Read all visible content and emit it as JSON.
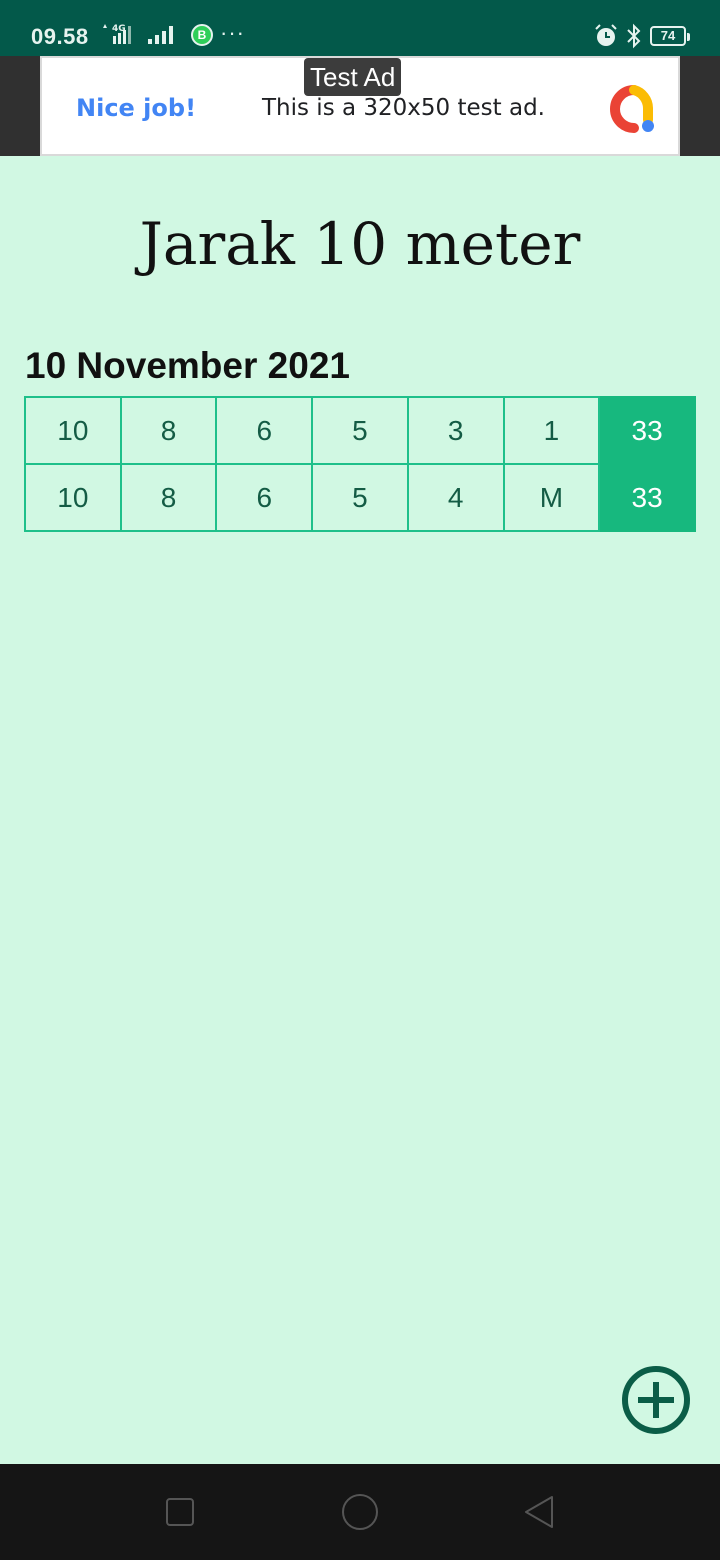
{
  "status_bar": {
    "time": "09.58",
    "network_type": "4G",
    "app_badge": "B",
    "more": "···",
    "battery": "74",
    "icons": [
      "signal-icon",
      "whatsapp-business-icon",
      "alarm-icon",
      "bluetooth-icon",
      "battery-icon"
    ]
  },
  "ad": {
    "label": "Test Ad",
    "headline": "Nice job!",
    "text": "This is a 320x50 test ad.",
    "icon": "adchoices-logo-icon",
    "colors": {
      "headline": "#4285f4",
      "red": "#ea4335",
      "yellow": "#fbbc04",
      "blue": "#4285f4"
    }
  },
  "page": {
    "title": "Jarak 10 meter"
  },
  "session": {
    "date": "10 November 2021",
    "rows": [
      {
        "shots": [
          "10",
          "8",
          "6",
          "5",
          "3",
          "1"
        ],
        "total": "33"
      },
      {
        "shots": [
          "10",
          "8",
          "6",
          "5",
          "4",
          "M"
        ],
        "total": "33"
      }
    ]
  },
  "fab": {
    "icon": "add-circle-icon"
  },
  "nav": {
    "icons": [
      "recents-icon",
      "home-icon",
      "back-icon"
    ]
  },
  "colors": {
    "status_bar": "#03594a",
    "background": "#d1f8e3",
    "cell_border": "#1ec08a",
    "total_cell": "#17b87e",
    "fab": "#0b5d47"
  }
}
